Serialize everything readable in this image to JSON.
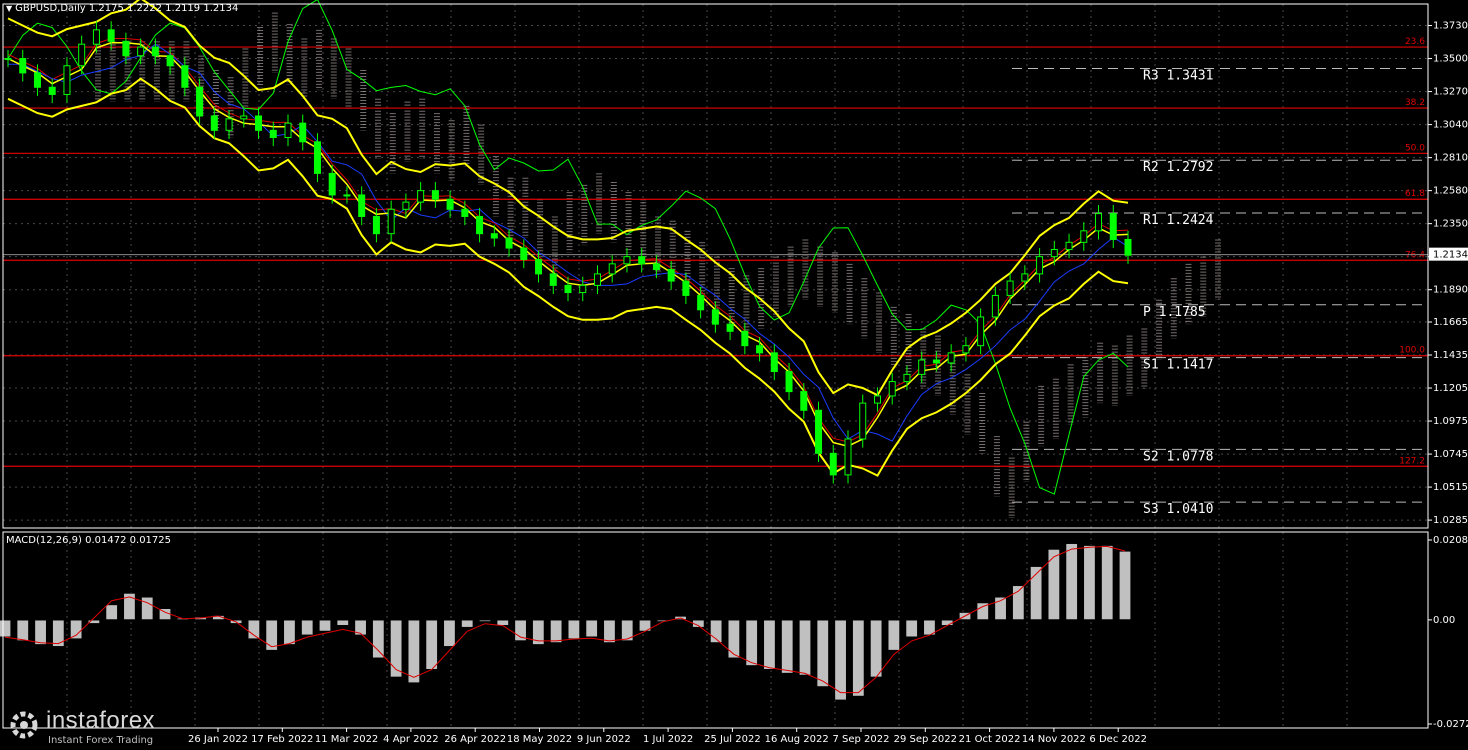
{
  "header": {
    "symbol_line": "GBPUSD,Daily  1.2175 1.2222 1.2119 1.2134"
  },
  "macd_header": "MACD(12,26,9) 0.01472 0.01725",
  "logo": {
    "brand": "instaforex",
    "tagline": "Instant Forex Trading"
  },
  "colors": {
    "background": "#000000",
    "grid": "#4a4a4a",
    "price": "#00ff00",
    "bands": "#ffff00",
    "ma_red": "#e00000",
    "ma_blue": "#1a3cff",
    "level": "#e00000",
    "macd_hist": "#c0c0c0",
    "macd_signal": "#e00000"
  },
  "chart_data": [
    {
      "type": "line",
      "title": "GBPUSD,Daily",
      "ylim": [
        1.023,
        1.388
      ],
      "y_ticks": [
        "1.3730",
        "1.3500",
        "1.3270",
        "1.3040",
        "1.2810",
        "1.2580",
        "1.2350",
        "1.2120",
        "1.1890",
        "1.1665",
        "1.1435",
        "1.1205",
        "1.0975",
        "1.0745",
        "1.0515",
        "1.0285"
      ],
      "x_ticks": [
        "26 Jan 2022",
        "17 Feb 2022",
        "11 Mar 2022",
        "4 Apr 2022",
        "26 Apr 2022",
        "18 May 2022",
        "9 Jun 2022",
        "1 Jul 2022",
        "25 Jul 2022",
        "16 Aug 2022",
        "7 Sep 2022",
        "29 Sep 2022",
        "21 Oct 2022",
        "14 Nov 2022",
        "6 Dec 2022"
      ],
      "current_price": "1.2134",
      "ohlc": {
        "open": 1.2175,
        "high": 1.2222,
        "low": 1.2119,
        "close": 1.2134
      },
      "close_series": [
        1.35,
        1.34,
        1.33,
        1.325,
        1.345,
        1.36,
        1.37,
        1.362,
        1.352,
        1.358,
        1.352,
        1.345,
        1.33,
        1.31,
        1.3,
        1.308,
        1.31,
        1.3,
        1.295,
        1.305,
        1.292,
        1.27,
        1.255,
        1.255,
        1.24,
        1.228,
        1.245,
        1.25,
        1.258,
        1.252,
        1.245,
        1.24,
        1.228,
        1.225,
        1.218,
        1.21,
        1.2,
        1.192,
        1.187,
        1.192,
        1.2,
        1.207,
        1.212,
        1.207,
        1.203,
        1.195,
        1.185,
        1.175,
        1.165,
        1.16,
        1.15,
        1.145,
        1.132,
        1.118,
        1.105,
        1.075,
        1.06,
        1.085,
        1.11,
        1.115,
        1.125,
        1.13,
        1.14,
        1.138,
        1.145,
        1.15,
        1.17,
        1.185,
        1.195,
        1.2,
        1.212,
        1.217,
        1.222,
        1.23,
        1.242,
        1.224,
        1.213
      ],
      "fib_levels": [
        {
          "label": "23.6",
          "price": 1.358
        },
        {
          "label": "38.2",
          "price": 1.3155
        },
        {
          "label": "50.0",
          "price": 1.284
        },
        {
          "label": "61.8",
          "price": 1.252
        },
        {
          "label": "76.4",
          "price": 1.2095
        },
        {
          "label": "100.0",
          "price": 1.143
        },
        {
          "label": "127.2",
          "price": 1.066
        }
      ],
      "pivots": [
        {
          "label": "R3 1.3431",
          "price": 1.3431
        },
        {
          "label": "R2 1.2792",
          "price": 1.2792
        },
        {
          "label": "R1 1.2424",
          "price": 1.2424
        },
        {
          "label": "P 1.1785",
          "price": 1.1785
        },
        {
          "label": "S1 1.1417",
          "price": 1.1417
        },
        {
          "label": "S2 1.0778",
          "price": 1.0778
        },
        {
          "label": "S3 1.0410",
          "price": 1.041
        }
      ]
    },
    {
      "type": "bar",
      "title": "MACD(12,26,9)",
      "macd": 0.01472,
      "signal": 0.01725,
      "y_ticks": [
        "0.02088",
        "0.00",
        "-0.02722"
      ],
      "ylim": [
        -0.02722,
        0.02088
      ],
      "histogram": [
        -0.0045,
        -0.0055,
        -0.0065,
        -0.007,
        -0.005,
        -0.001,
        0.004,
        0.007,
        0.006,
        0.003,
        0.0005,
        0.0008,
        0.0012,
        -0.001,
        -0.005,
        -0.008,
        -0.0065,
        -0.004,
        -0.003,
        -0.0015,
        -0.004,
        -0.01,
        -0.015,
        -0.0165,
        -0.013,
        -0.007,
        -0.002,
        -0.0005,
        -0.0015,
        -0.0055,
        -0.0065,
        -0.006,
        -0.005,
        -0.0045,
        -0.006,
        -0.0055,
        -0.003,
        -0.0005,
        0.001,
        -0.002,
        -0.006,
        -0.01,
        -0.012,
        -0.013,
        -0.014,
        -0.0145,
        -0.0175,
        -0.021,
        -0.02,
        -0.015,
        -0.008,
        -0.0045,
        -0.004,
        -0.0015,
        0.002,
        0.0045,
        0.006,
        0.009,
        0.014,
        0.0185,
        0.02,
        0.0195,
        0.0195,
        0.018
      ],
      "signal_series": [
        -0.0045,
        -0.0052,
        -0.006,
        -0.0062,
        -0.004,
        0.0005,
        0.005,
        0.006,
        0.0045,
        0.002,
        0.0003,
        0.0005,
        0.001,
        -0.0005,
        -0.004,
        -0.007,
        -0.0062,
        -0.0045,
        -0.0035,
        -0.0025,
        -0.0035,
        -0.008,
        -0.013,
        -0.015,
        -0.013,
        -0.008,
        -0.003,
        -0.001,
        -0.0015,
        -0.0045,
        -0.0055,
        -0.0055,
        -0.005,
        -0.0048,
        -0.0055,
        -0.005,
        -0.003,
        -0.0005,
        0.0005,
        -0.0015,
        -0.005,
        -0.009,
        -0.0112,
        -0.0125,
        -0.0132,
        -0.014,
        -0.016,
        -0.019,
        -0.019,
        -0.015,
        -0.009,
        -0.0055,
        -0.004,
        -0.0015,
        0.001,
        0.0035,
        0.005,
        0.0075,
        0.012,
        0.0165,
        0.0185,
        0.019,
        0.0192,
        0.018
      ]
    }
  ]
}
